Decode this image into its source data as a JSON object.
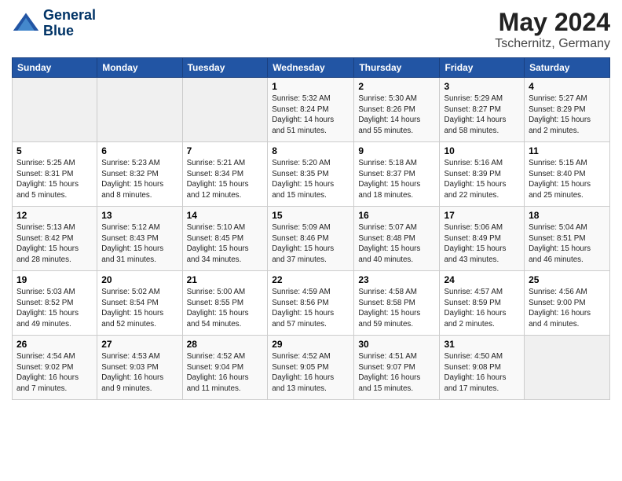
{
  "header": {
    "logo_line1": "General",
    "logo_line2": "Blue",
    "month": "May 2024",
    "location": "Tschernitz, Germany"
  },
  "weekdays": [
    "Sunday",
    "Monday",
    "Tuesday",
    "Wednesday",
    "Thursday",
    "Friday",
    "Saturday"
  ],
  "weeks": [
    [
      {
        "day": "",
        "info": ""
      },
      {
        "day": "",
        "info": ""
      },
      {
        "day": "",
        "info": ""
      },
      {
        "day": "1",
        "info": "Sunrise: 5:32 AM\nSunset: 8:24 PM\nDaylight: 14 hours\nand 51 minutes."
      },
      {
        "day": "2",
        "info": "Sunrise: 5:30 AM\nSunset: 8:26 PM\nDaylight: 14 hours\nand 55 minutes."
      },
      {
        "day": "3",
        "info": "Sunrise: 5:29 AM\nSunset: 8:27 PM\nDaylight: 14 hours\nand 58 minutes."
      },
      {
        "day": "4",
        "info": "Sunrise: 5:27 AM\nSunset: 8:29 PM\nDaylight: 15 hours\nand 2 minutes."
      }
    ],
    [
      {
        "day": "5",
        "info": "Sunrise: 5:25 AM\nSunset: 8:31 PM\nDaylight: 15 hours\nand 5 minutes."
      },
      {
        "day": "6",
        "info": "Sunrise: 5:23 AM\nSunset: 8:32 PM\nDaylight: 15 hours\nand 8 minutes."
      },
      {
        "day": "7",
        "info": "Sunrise: 5:21 AM\nSunset: 8:34 PM\nDaylight: 15 hours\nand 12 minutes."
      },
      {
        "day": "8",
        "info": "Sunrise: 5:20 AM\nSunset: 8:35 PM\nDaylight: 15 hours\nand 15 minutes."
      },
      {
        "day": "9",
        "info": "Sunrise: 5:18 AM\nSunset: 8:37 PM\nDaylight: 15 hours\nand 18 minutes."
      },
      {
        "day": "10",
        "info": "Sunrise: 5:16 AM\nSunset: 8:39 PM\nDaylight: 15 hours\nand 22 minutes."
      },
      {
        "day": "11",
        "info": "Sunrise: 5:15 AM\nSunset: 8:40 PM\nDaylight: 15 hours\nand 25 minutes."
      }
    ],
    [
      {
        "day": "12",
        "info": "Sunrise: 5:13 AM\nSunset: 8:42 PM\nDaylight: 15 hours\nand 28 minutes."
      },
      {
        "day": "13",
        "info": "Sunrise: 5:12 AM\nSunset: 8:43 PM\nDaylight: 15 hours\nand 31 minutes."
      },
      {
        "day": "14",
        "info": "Sunrise: 5:10 AM\nSunset: 8:45 PM\nDaylight: 15 hours\nand 34 minutes."
      },
      {
        "day": "15",
        "info": "Sunrise: 5:09 AM\nSunset: 8:46 PM\nDaylight: 15 hours\nand 37 minutes."
      },
      {
        "day": "16",
        "info": "Sunrise: 5:07 AM\nSunset: 8:48 PM\nDaylight: 15 hours\nand 40 minutes."
      },
      {
        "day": "17",
        "info": "Sunrise: 5:06 AM\nSunset: 8:49 PM\nDaylight: 15 hours\nand 43 minutes."
      },
      {
        "day": "18",
        "info": "Sunrise: 5:04 AM\nSunset: 8:51 PM\nDaylight: 15 hours\nand 46 minutes."
      }
    ],
    [
      {
        "day": "19",
        "info": "Sunrise: 5:03 AM\nSunset: 8:52 PM\nDaylight: 15 hours\nand 49 minutes."
      },
      {
        "day": "20",
        "info": "Sunrise: 5:02 AM\nSunset: 8:54 PM\nDaylight: 15 hours\nand 52 minutes."
      },
      {
        "day": "21",
        "info": "Sunrise: 5:00 AM\nSunset: 8:55 PM\nDaylight: 15 hours\nand 54 minutes."
      },
      {
        "day": "22",
        "info": "Sunrise: 4:59 AM\nSunset: 8:56 PM\nDaylight: 15 hours\nand 57 minutes."
      },
      {
        "day": "23",
        "info": "Sunrise: 4:58 AM\nSunset: 8:58 PM\nDaylight: 15 hours\nand 59 minutes."
      },
      {
        "day": "24",
        "info": "Sunrise: 4:57 AM\nSunset: 8:59 PM\nDaylight: 16 hours\nand 2 minutes."
      },
      {
        "day": "25",
        "info": "Sunrise: 4:56 AM\nSunset: 9:00 PM\nDaylight: 16 hours\nand 4 minutes."
      }
    ],
    [
      {
        "day": "26",
        "info": "Sunrise: 4:54 AM\nSunset: 9:02 PM\nDaylight: 16 hours\nand 7 minutes."
      },
      {
        "day": "27",
        "info": "Sunrise: 4:53 AM\nSunset: 9:03 PM\nDaylight: 16 hours\nand 9 minutes."
      },
      {
        "day": "28",
        "info": "Sunrise: 4:52 AM\nSunset: 9:04 PM\nDaylight: 16 hours\nand 11 minutes."
      },
      {
        "day": "29",
        "info": "Sunrise: 4:52 AM\nSunset: 9:05 PM\nDaylight: 16 hours\nand 13 minutes."
      },
      {
        "day": "30",
        "info": "Sunrise: 4:51 AM\nSunset: 9:07 PM\nDaylight: 16 hours\nand 15 minutes."
      },
      {
        "day": "31",
        "info": "Sunrise: 4:50 AM\nSunset: 9:08 PM\nDaylight: 16 hours\nand 17 minutes."
      },
      {
        "day": "",
        "info": ""
      }
    ]
  ]
}
